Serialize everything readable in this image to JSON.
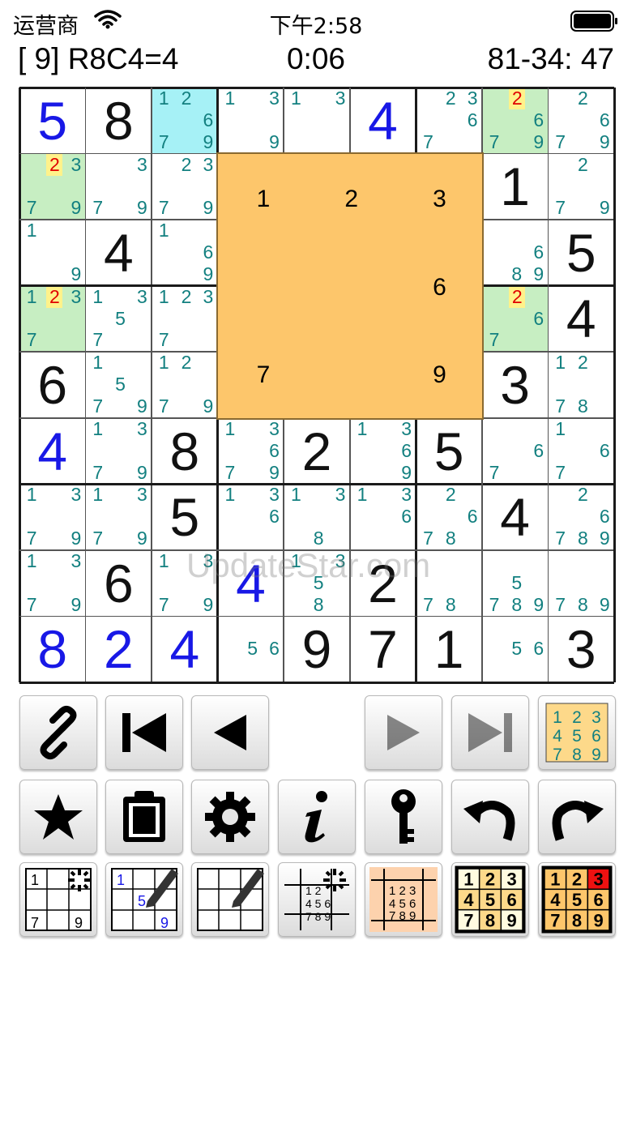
{
  "status_bar": {
    "carrier": "运营商",
    "time": "下午2:58"
  },
  "info_bar": {
    "cell_info": "[ 9] R8C4=4",
    "timer": "0:06",
    "progress": "81-34: 47"
  },
  "watermark": "UpdateStar.com",
  "colors": {
    "orange_panel": "#fdc66b",
    "highlight_green": "#c7eec2",
    "highlight_cyan": "#a6f1f6",
    "user_digit": "#1818e6",
    "candidate": "#138080"
  },
  "orange_panel_digits": [
    "1",
    "2",
    "3",
    "",
    "",
    "6",
    "7",
    "",
    "9"
  ],
  "cells": [
    {
      "v": "5",
      "type": "user"
    },
    {
      "v": "8",
      "type": "orig"
    },
    {
      "c": [
        "1",
        "2",
        "",
        "",
        "",
        "6",
        "7",
        "",
        "9"
      ],
      "bg": "cyan"
    },
    {
      "c": [
        "1",
        "",
        "3",
        "",
        "",
        "",
        "",
        "",
        "9"
      ]
    },
    {
      "c": [
        "1",
        "",
        "3",
        "",
        "",
        "",
        "",
        "",
        ""
      ]
    },
    {
      "v": "4",
      "type": "user"
    },
    {
      "c": [
        "",
        "2",
        "3",
        "",
        "",
        "6",
        "7",
        "",
        ""
      ]
    },
    {
      "c": [
        "",
        "2",
        "",
        "",
        "",
        "6",
        "7",
        "",
        "9"
      ],
      "bg": "green",
      "red": "2"
    },
    {
      "c": [
        "",
        "2",
        "",
        "",
        "",
        "6",
        "7",
        "",
        "9"
      ]
    },
    {
      "c": [
        "",
        "2",
        "3",
        "",
        "",
        "",
        "7",
        "",
        "9"
      ],
      "bg": "green",
      "red": "2"
    },
    {
      "c": [
        "",
        "",
        "3",
        "",
        "",
        "",
        "7",
        "",
        "9"
      ]
    },
    {
      "c": [
        "",
        "2",
        "3",
        "",
        "",
        "",
        "7",
        "",
        "9"
      ]
    },
    {
      "hidden": true
    },
    {
      "hidden": true
    },
    {
      "hidden": true
    },
    {
      "hidden": true
    },
    {
      "v": "1",
      "type": "orig"
    },
    {
      "c": [
        "",
        "2",
        "",
        "",
        "",
        "",
        "7",
        "",
        "9"
      ]
    },
    {
      "c": [
        "1",
        "",
        "",
        "",
        "",
        "",
        "",
        "",
        "9"
      ]
    },
    {
      "v": "4",
      "type": "orig"
    },
    {
      "c": [
        "1",
        "",
        "",
        "",
        "",
        "6",
        "",
        "",
        "9"
      ]
    },
    {
      "hidden": true
    },
    {
      "hidden": true
    },
    {
      "hidden": true
    },
    {
      "hidden": true
    },
    {
      "c": [
        "",
        "",
        "",
        "",
        "",
        "6",
        "",
        "8",
        "9"
      ]
    },
    {
      "v": "5",
      "type": "orig"
    },
    {
      "c": [
        "1",
        "2",
        "3",
        "",
        "",
        "",
        "7",
        "",
        ""
      ],
      "bg": "green",
      "red": "2"
    },
    {
      "c": [
        "1",
        "",
        "3",
        "",
        "5",
        "",
        "7",
        "",
        ""
      ]
    },
    {
      "c": [
        "1",
        "2",
        "3",
        "",
        "",
        "",
        "7",
        "",
        ""
      ]
    },
    {
      "hidden": true
    },
    {
      "hidden": true
    },
    {
      "hidden": true
    },
    {
      "hidden": true
    },
    {
      "c": [
        "",
        "2",
        "",
        "",
        "",
        "6",
        "7",
        "",
        ""
      ],
      "bg": "green",
      "red": "2"
    },
    {
      "v": "4",
      "type": "orig"
    },
    {
      "v": "6",
      "type": "orig"
    },
    {
      "c": [
        "1",
        "",
        "",
        "",
        "5",
        "",
        "7",
        "",
        "9"
      ]
    },
    {
      "c": [
        "1",
        "2",
        "",
        "",
        "",
        "",
        "7",
        "",
        "9"
      ]
    },
    {
      "hidden": true
    },
    {
      "hidden": true
    },
    {
      "hidden": true
    },
    {
      "hidden": true
    },
    {
      "v": "3",
      "type": "orig"
    },
    {
      "c": [
        "1",
        "2",
        "",
        "",
        "",
        "",
        "7",
        "8",
        ""
      ]
    },
    {
      "v": "4",
      "type": "user"
    },
    {
      "c": [
        "1",
        "",
        "3",
        "",
        "",
        "",
        "7",
        "",
        "9"
      ]
    },
    {
      "v": "8",
      "type": "orig"
    },
    {
      "c": [
        "1",
        "",
        "3",
        "",
        "",
        "6",
        "7",
        "",
        "9"
      ]
    },
    {
      "v": "2",
      "type": "orig"
    },
    {
      "c": [
        "1",
        "",
        "3",
        "",
        "",
        "6",
        "",
        "",
        "9"
      ]
    },
    {
      "v": "5",
      "type": "orig"
    },
    {
      "c": [
        "",
        "",
        "",
        "",
        "",
        "6",
        "7",
        "",
        ""
      ]
    },
    {
      "c": [
        "1",
        "",
        "",
        "",
        "",
        "6",
        "7",
        "",
        ""
      ]
    },
    {
      "c": [
        "1",
        "",
        "3",
        "",
        "",
        "",
        "7",
        "",
        "9"
      ]
    },
    {
      "c": [
        "1",
        "",
        "3",
        "",
        "",
        "",
        "7",
        "",
        "9"
      ]
    },
    {
      "v": "5",
      "type": "orig"
    },
    {
      "c": [
        "1",
        "",
        "3",
        "",
        "",
        "6",
        "",
        "",
        ""
      ]
    },
    {
      "c": [
        "1",
        "",
        "3",
        "",
        "",
        "",
        "",
        "8",
        ""
      ]
    },
    {
      "c": [
        "1",
        "",
        "3",
        "",
        "",
        "6",
        "",
        "",
        ""
      ]
    },
    {
      "c": [
        "",
        "2",
        "",
        "",
        "",
        "6",
        "7",
        "8",
        ""
      ]
    },
    {
      "v": "4",
      "type": "orig"
    },
    {
      "c": [
        "",
        "2",
        "",
        "",
        "",
        "6",
        "7",
        "8",
        "9"
      ]
    },
    {
      "c": [
        "1",
        "",
        "3",
        "",
        "",
        "",
        "7",
        "",
        "9"
      ]
    },
    {
      "v": "6",
      "type": "orig"
    },
    {
      "c": [
        "1",
        "",
        "3",
        "",
        "",
        "",
        "7",
        "",
        "9"
      ]
    },
    {
      "v": "4",
      "type": "user"
    },
    {
      "c": [
        "1",
        "",
        "3",
        "",
        "5",
        "",
        "",
        "8",
        ""
      ]
    },
    {
      "v": "2",
      "type": "orig"
    },
    {
      "c": [
        "",
        "",
        "",
        "",
        "",
        "",
        "7",
        "8",
        ""
      ]
    },
    {
      "c": [
        "",
        "",
        "",
        "",
        "5",
        "",
        "7",
        "8",
        "9"
      ]
    },
    {
      "c": [
        "",
        "",
        "",
        "",
        "",
        "",
        "7",
        "8",
        "9"
      ]
    },
    {
      "v": "8",
      "type": "user"
    },
    {
      "v": "2",
      "type": "user"
    },
    {
      "v": "4",
      "type": "user"
    },
    {
      "c": [
        "",
        "",
        "",
        "",
        "5",
        "6",
        "",
        "",
        ""
      ]
    },
    {
      "v": "9",
      "type": "orig"
    },
    {
      "v": "7",
      "type": "orig"
    },
    {
      "v": "1",
      "type": "orig"
    },
    {
      "c": [
        "",
        "",
        "",
        "",
        "5",
        "6",
        "",
        "",
        ""
      ]
    },
    {
      "v": "3",
      "type": "orig"
    }
  ],
  "toolbar": {
    "row1": [
      "link-icon",
      "first-step-icon",
      "previous-step-icon",
      "",
      "next-step-icon",
      "last-step-icon",
      "candidates-grid-icon"
    ],
    "row2": [
      "star-icon",
      "clipboard-icon",
      "settings-gear-icon",
      "info-icon",
      "key-icon",
      "undo-icon",
      "redo-icon"
    ],
    "row3": [
      "mode-auto-candidates-icon",
      "mode-edit-candidates-icon",
      "mode-pencil-icon",
      "mode-auto-pencil-icon",
      "keypad-candidates-icon",
      "keypad-yellow-icon",
      "keypad-orange-icon"
    ],
    "mini_digits": [
      "1",
      "2",
      "3",
      "4",
      "5",
      "6",
      "7",
      "8",
      "9"
    ],
    "mini_corner": [
      "1",
      "7",
      "9",
      "5"
    ]
  }
}
